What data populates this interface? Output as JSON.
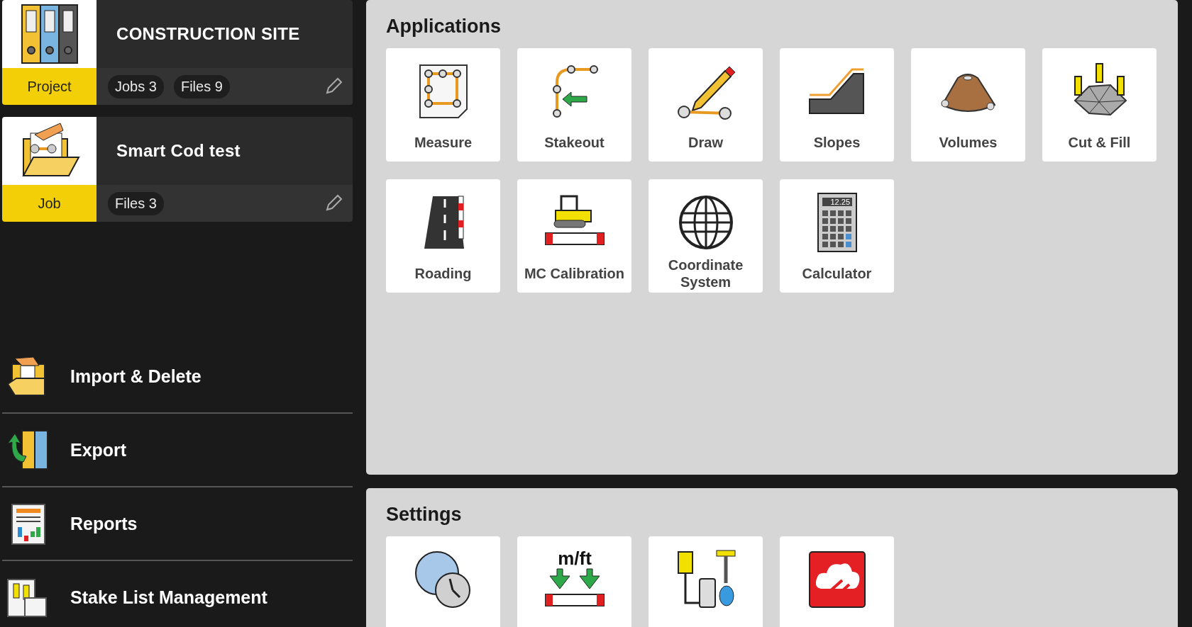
{
  "cards": [
    {
      "kind": "project",
      "badge": "Project",
      "title": "CONSTRUCTION SITE",
      "chips": [
        "Jobs 3",
        "Files 9"
      ]
    },
    {
      "kind": "job",
      "badge": "Job",
      "title": "Smart Cod test",
      "chips": [
        "Files 3"
      ]
    }
  ],
  "menu": [
    {
      "kind": "import",
      "label": "Import & Delete"
    },
    {
      "kind": "export",
      "label": "Export"
    },
    {
      "kind": "reports",
      "label": "Reports"
    },
    {
      "kind": "stakelist",
      "label": "Stake List Management"
    }
  ],
  "sections": [
    {
      "title": "Applications",
      "tiles": [
        {
          "kind": "measure",
          "label": "Measure"
        },
        {
          "kind": "stakeout",
          "label": "Stakeout"
        },
        {
          "kind": "draw",
          "label": "Draw"
        },
        {
          "kind": "slopes",
          "label": "Slopes"
        },
        {
          "kind": "volumes",
          "label": "Volumes"
        },
        {
          "kind": "cutfill",
          "label": "Cut & Fill"
        },
        {
          "kind": "roading",
          "label": "Roading"
        },
        {
          "kind": "mc",
          "label": "MC Calibration"
        },
        {
          "kind": "coordinate",
          "label": "Coordinate System"
        },
        {
          "kind": "calculator",
          "label": "Calculator",
          "icon_text": "12.25"
        }
      ]
    },
    {
      "title": "Settings",
      "tiles": [
        {
          "kind": "system"
        },
        {
          "kind": "units",
          "icon_text": "m/ft"
        },
        {
          "kind": "devices"
        },
        {
          "kind": "clouds"
        }
      ]
    }
  ]
}
